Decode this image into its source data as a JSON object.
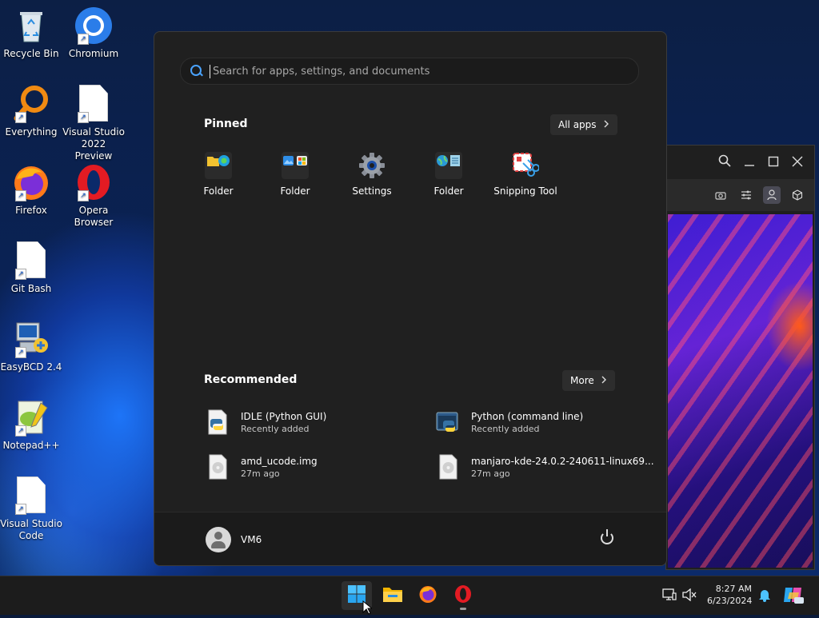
{
  "desktop": {
    "icons": [
      {
        "label": "Recycle Bin"
      },
      {
        "label": "Chromium"
      },
      {
        "label": "Everything"
      },
      {
        "label": "Visual Studio 2022 Preview"
      },
      {
        "label": "Firefox"
      },
      {
        "label": "Opera Browser"
      },
      {
        "label": "Git Bash"
      },
      {
        "label": "EasyBCD 2.4"
      },
      {
        "label": "Notepad++"
      },
      {
        "label": "Visual Studio Code"
      }
    ]
  },
  "start_menu": {
    "search": {
      "placeholder": "Search for apps, settings, and documents"
    },
    "pinned": {
      "title": "Pinned",
      "all_apps_label": "All apps",
      "items": [
        {
          "label": "Folder"
        },
        {
          "label": "Folder"
        },
        {
          "label": "Settings"
        },
        {
          "label": "Folder"
        },
        {
          "label": "Snipping Tool"
        }
      ]
    },
    "recommended": {
      "title": "Recommended",
      "more_label": "More",
      "items": [
        {
          "title": "IDLE (Python GUI)",
          "subtitle": "Recently added"
        },
        {
          "title": "Python (command line)",
          "subtitle": "Recently added"
        },
        {
          "title": "amd_ucode.img",
          "subtitle": "27m ago"
        },
        {
          "title": "manjaro-kde-24.0.2-240611-linux69...",
          "subtitle": "27m ago"
        }
      ]
    },
    "user": {
      "name": "VM6"
    }
  },
  "taskbar": {
    "time": "8:27 AM",
    "date": "6/23/2024"
  },
  "colors": {
    "accent": "#4aa3ff",
    "menu_bg": "#202020",
    "taskbar_bg": "#1c1c1c"
  }
}
